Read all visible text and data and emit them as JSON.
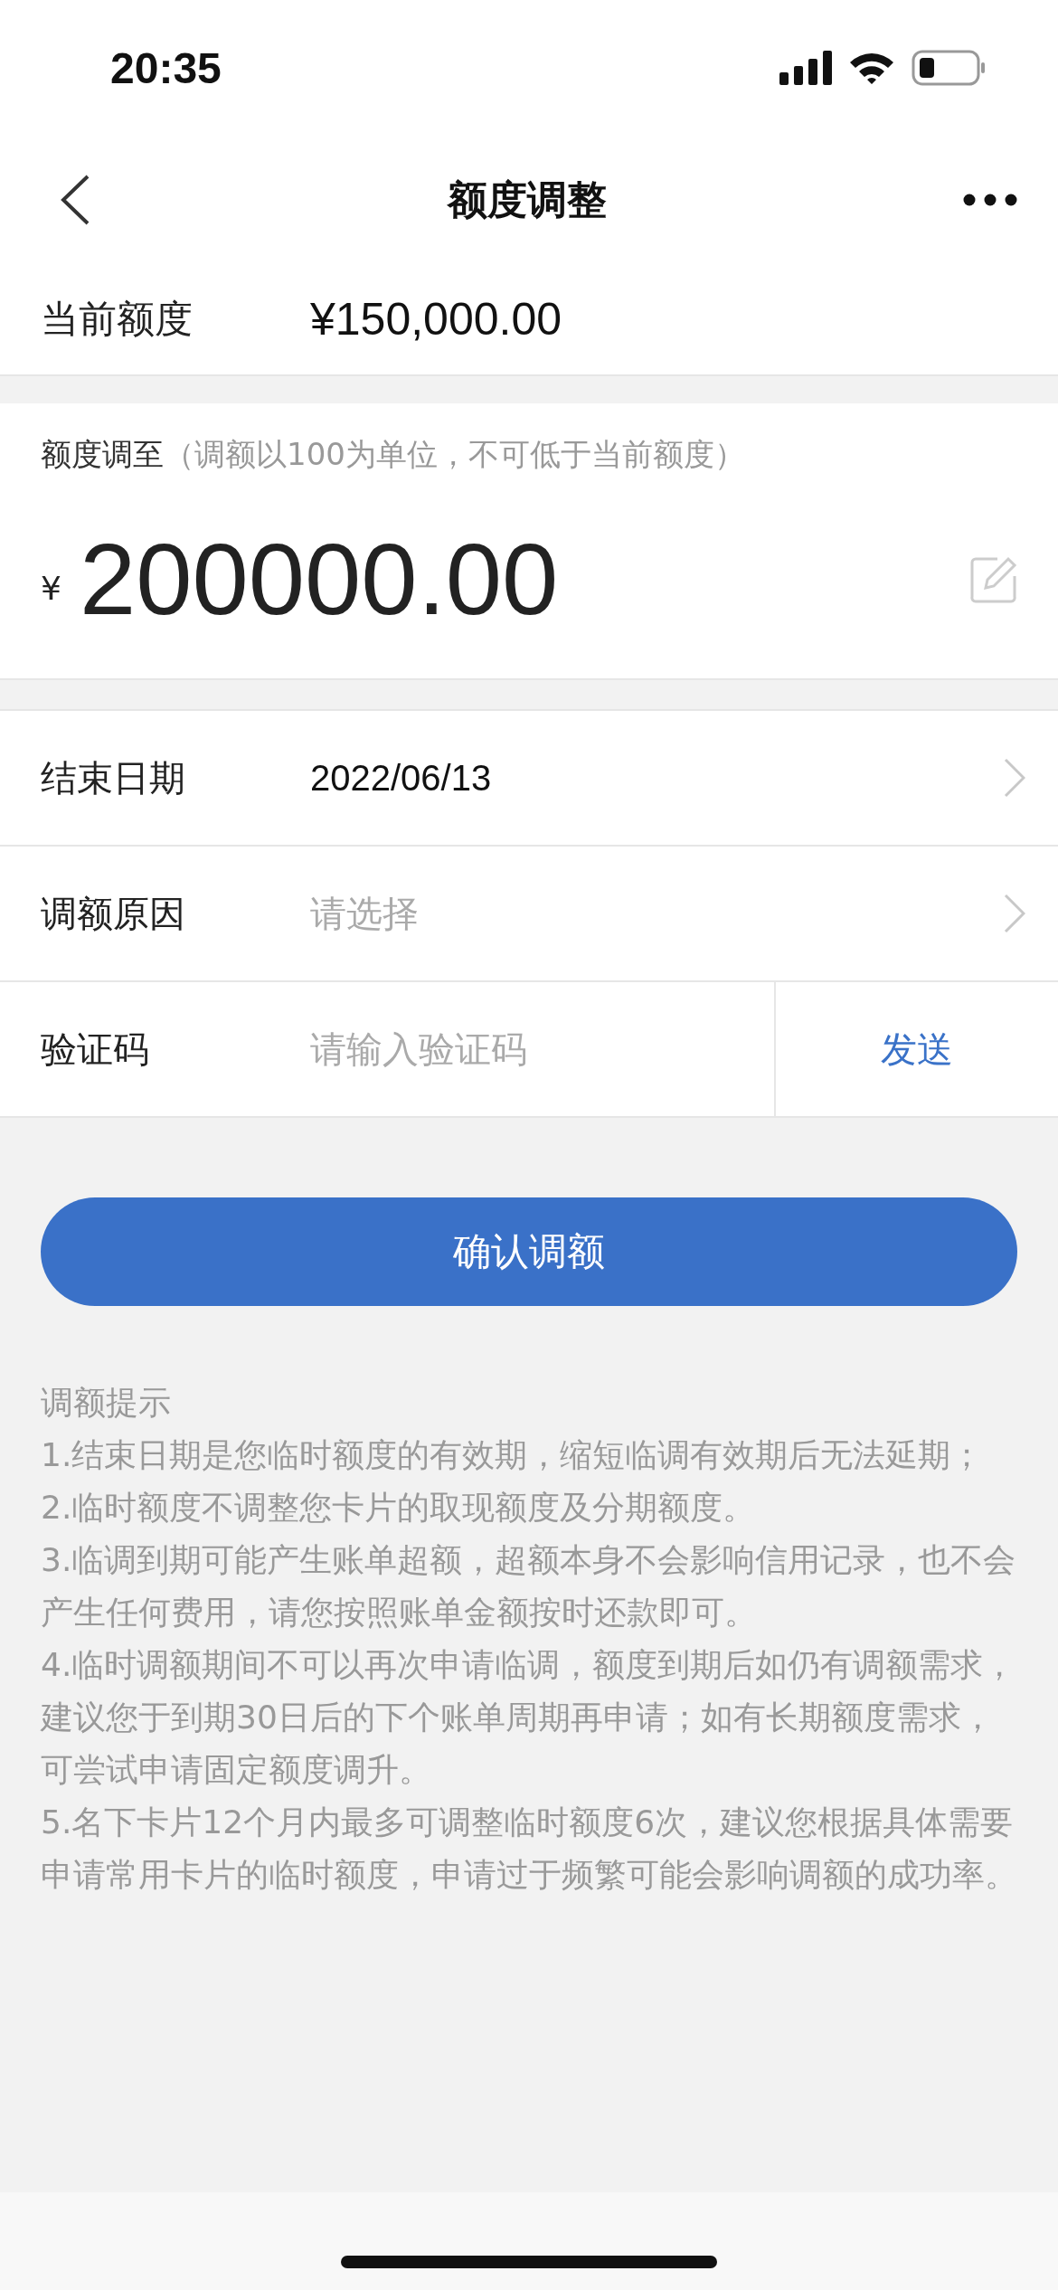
{
  "status_bar": {
    "time": "20:35"
  },
  "nav": {
    "title": "额度调整"
  },
  "current_limit": {
    "label": "当前额度",
    "value": "¥150,000.00"
  },
  "adjust": {
    "label": "额度调至",
    "hint": "（调额以100为单位，不可低于当前额度）",
    "currency": "¥",
    "amount": "200000.00"
  },
  "form_rows": [
    {
      "kind": "select",
      "label": "结束日期",
      "value": "2022/06/13"
    },
    {
      "kind": "select",
      "label": "调额原因",
      "placeholder": "请选择"
    },
    {
      "kind": "code",
      "label": "验证码",
      "placeholder": "请输入验证码",
      "action": "发送"
    }
  ],
  "confirm_button": "确认调额",
  "tips": {
    "title": "调额提示",
    "items": [
      "1.结束日期是您临时额度的有效期，缩短临调有效期后无法延期；",
      "2.临时额度不调整您卡片的取现额度及分期额度。",
      "3.临调到期可能产生账单超额，超额本身不会影响信用记录，也不会产生任何费用，请您按照账单金额按时还款即可。",
      "4.临时调额期间不可以再次申请临调，额度到期后如仍有调额需求，建议您于到期30日后的下个账单周期再申请；如有长期额度需求，可尝试申请固定额度调升。",
      "5.名下卡片12个月内最多可调整临时额度6次，建议您根据具体需要申请常用卡片的临时额度，申请过于频繁可能会影响调额的成功率。"
    ]
  }
}
